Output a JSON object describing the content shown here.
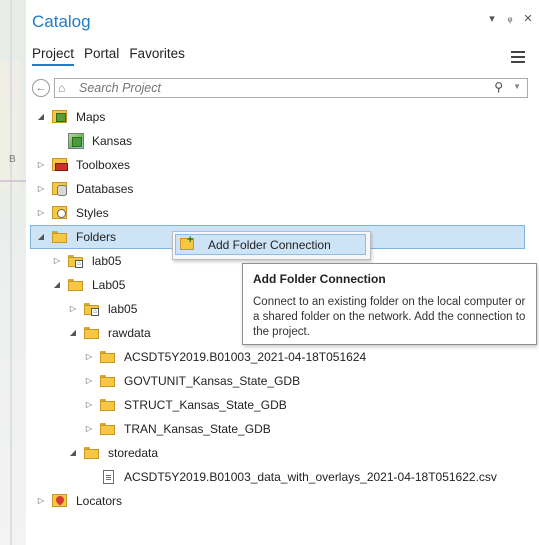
{
  "panel": {
    "title": "Catalog",
    "title_buttons": [
      "▾",
      "📌",
      "✕"
    ],
    "accent_color": "#1e7dc8"
  },
  "tabs": [
    {
      "label": "Project",
      "active": true
    },
    {
      "label": "Portal",
      "active": false
    },
    {
      "label": "Favorites",
      "active": false
    }
  ],
  "search": {
    "placeholder": "Search Project",
    "value": ""
  },
  "tree": {
    "maps": "Maps",
    "kansas": "Kansas",
    "toolboxes": "Toolboxes",
    "databases": "Databases",
    "styles": "Styles",
    "folders": "Folders",
    "lab05a": "lab05",
    "lab05b": "Lab05",
    "lab05c": "lab05",
    "rawdata": "rawdata",
    "acs": "ACSDT5Y2019.B01003_2021-04-18T051624",
    "govt": "GOVTUNIT_Kansas_State_GDB",
    "struct": "STRUCT_Kansas_State_GDB",
    "tran": "TRAN_Kansas_State_GDB",
    "storedata": "storedata",
    "csv": "ACSDT5Y2019.B01003_data_with_overlays_2021-04-18T051622.csv",
    "locators": "Locators"
  },
  "context_menu": {
    "add_folder": "Add Folder Connection"
  },
  "tooltip": {
    "title": "Add Folder Connection",
    "body": "Connect to an existing folder on the local computer or a shared folder on the network. Add the connection to the project."
  },
  "map_label": "B"
}
